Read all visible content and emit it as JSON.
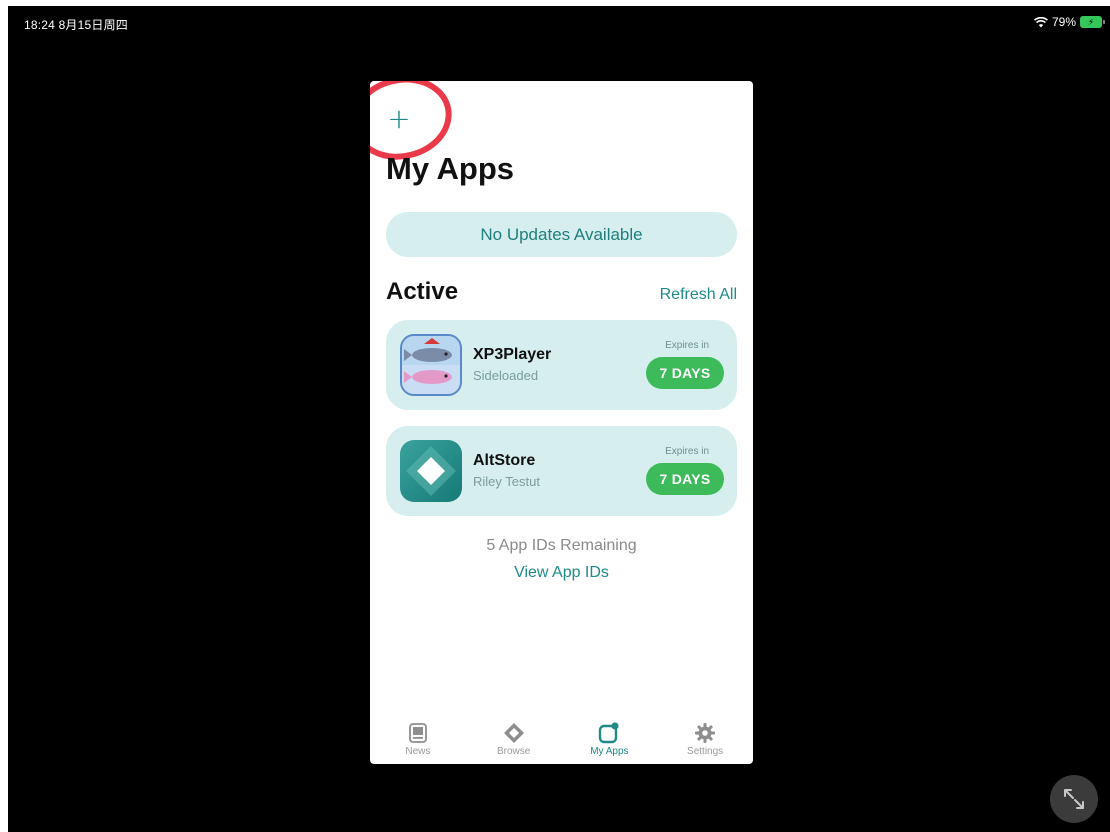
{
  "status": {
    "time": "18:24  8月15日周四",
    "battery": "79%"
  },
  "app": {
    "title": "My Apps",
    "add_icon": "plus-icon",
    "updates_banner": "No Updates Available",
    "section": {
      "title": "Active",
      "action": "Refresh All"
    },
    "apps": [
      {
        "name": "XP3Player",
        "subtitle": "Sideloaded",
        "expires_label": "Expires in",
        "expires_value": "7 DAYS",
        "icon": "xp3player-icon"
      },
      {
        "name": "AltStore",
        "subtitle": "Riley Testut",
        "expires_label": "Expires in",
        "expires_value": "7 DAYS",
        "icon": "altstore-icon"
      }
    ],
    "footer": {
      "remaining": "5 App IDs Remaining",
      "link": "View App IDs"
    },
    "tabs": [
      {
        "label": "News",
        "icon": "news-icon",
        "active": false
      },
      {
        "label": "Browse",
        "icon": "browse-icon",
        "active": false
      },
      {
        "label": "My Apps",
        "icon": "my-apps-icon",
        "active": true
      },
      {
        "label": "Settings",
        "icon": "gear-icon",
        "active": false
      }
    ]
  },
  "colors": {
    "accent": "#1f8a88",
    "card": "#d6eeee",
    "badge": "#3dbb5a",
    "annotation": "#ea3a4a"
  }
}
